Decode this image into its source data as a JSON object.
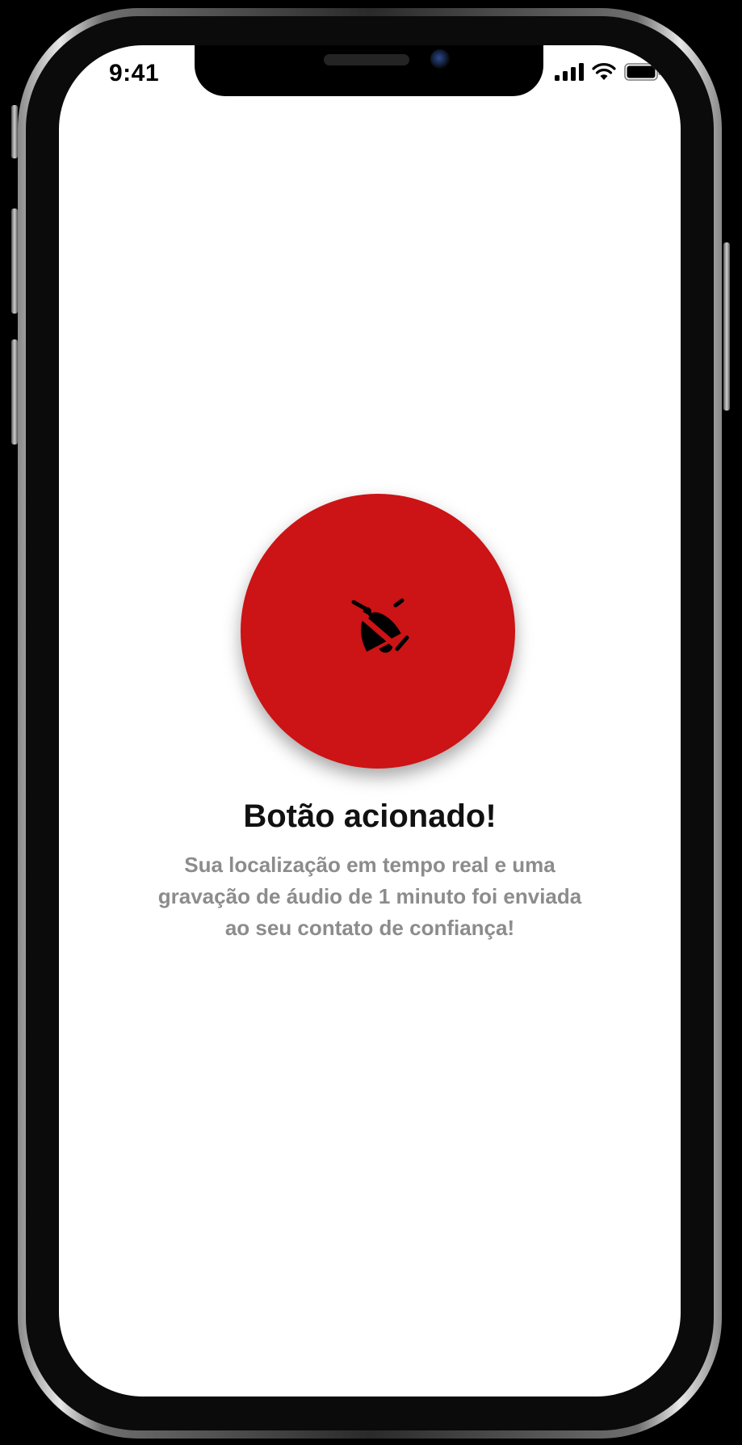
{
  "status_bar": {
    "time": "9:41",
    "icons": [
      "signal-icon",
      "wifi-icon",
      "battery-icon"
    ]
  },
  "alert": {
    "icon": "bell-off-icon",
    "button_color": "#cc1315",
    "title": "Botão acionado!",
    "message": "Sua localização em tempo real e uma gravação de áudio de 1 minuto foi enviada ao seu contato de confiança!"
  }
}
